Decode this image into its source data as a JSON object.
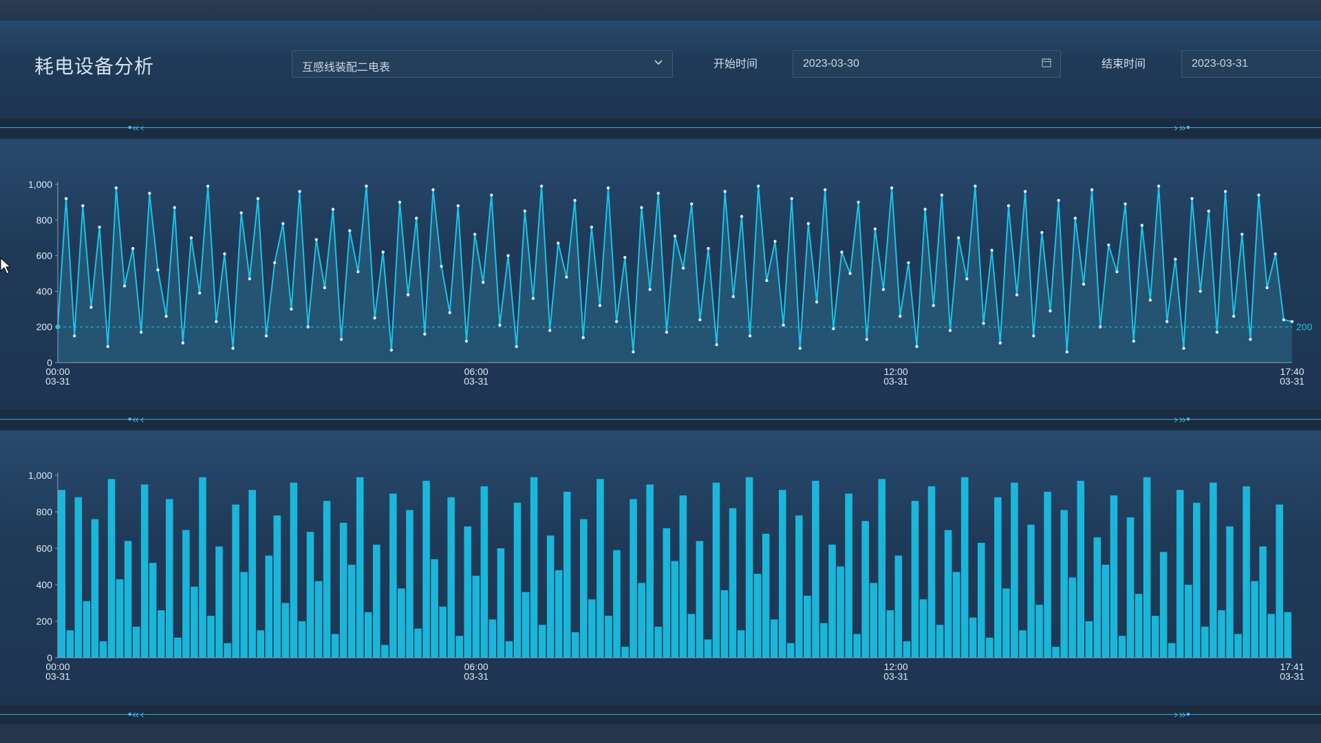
{
  "page": {
    "title": "耗电设备分析",
    "device_select": "互感线装配二电表",
    "start_label": "开始时间",
    "start_date": "2023-03-30",
    "end_label": "结束时间",
    "end_date": "2023-03-31"
  },
  "colors": {
    "accent": "#19c4e8",
    "panel": "#244466",
    "bg": "#1f3147"
  },
  "divider": {
    "left_arrows": "•‹‹ ‹",
    "right_arrows": "› ››•"
  },
  "chart_data": [
    {
      "type": "line",
      "y_ticks": [
        "1,000",
        "800",
        "600",
        "400",
        "200",
        "0"
      ],
      "ylim": [
        0,
        1000
      ],
      "x_ticks": [
        {
          "time": "00:00",
          "date": "03-31"
        },
        {
          "time": "06:00",
          "date": "03-31"
        },
        {
          "time": "12:00",
          "date": "03-31"
        },
        {
          "time": "17:40",
          "date": "03-31"
        }
      ],
      "xlim": [
        "03-31 00:00",
        "03-31 17:40"
      ],
      "markline": {
        "value": 200,
        "label": "200"
      },
      "values": [
        200,
        920,
        150,
        880,
        310,
        760,
        90,
        980,
        430,
        640,
        170,
        950,
        520,
        260,
        870,
        110,
        700,
        390,
        990,
        230,
        610,
        80,
        840,
        470,
        920,
        150,
        560,
        780,
        300,
        960,
        200,
        690,
        420,
        860,
        130,
        740,
        510,
        990,
        250,
        620,
        70,
        900,
        380,
        810,
        160,
        970,
        540,
        280,
        880,
        120,
        720,
        450,
        940,
        210,
        600,
        90,
        850,
        360,
        990,
        180,
        670,
        480,
        910,
        140,
        760,
        320,
        980,
        230,
        590,
        60,
        870,
        410,
        950,
        170,
        710,
        530,
        890,
        240,
        640,
        100,
        960,
        370,
        820,
        150,
        990,
        460,
        680,
        210,
        920,
        80,
        780,
        340,
        970,
        190,
        620,
        500,
        900,
        130,
        750,
        410,
        980,
        260,
        560,
        90,
        860,
        320,
        940,
        180,
        700,
        470,
        990,
        220,
        630,
        110,
        880,
        380,
        960,
        150,
        730,
        290,
        910,
        60,
        810,
        440,
        970,
        200,
        660,
        510,
        890,
        120,
        770,
        350,
        990,
        230,
        580,
        80,
        920,
        400,
        850,
        170,
        960,
        260,
        720,
        130,
        940,
        420,
        610,
        240,
        230
      ]
    },
    {
      "type": "bar",
      "y_ticks": [
        "1,000",
        "800",
        "600",
        "400",
        "200",
        "0"
      ],
      "ylim": [
        0,
        1000
      ],
      "x_ticks": [
        {
          "time": "00:00",
          "date": "03-31"
        },
        {
          "time": "06:00",
          "date": "03-31"
        },
        {
          "time": "12:00",
          "date": "03-31"
        },
        {
          "time": "17:41",
          "date": "03-31"
        }
      ],
      "xlim": [
        "03-31 00:00",
        "03-31 17:41"
      ],
      "values": [
        920,
        150,
        880,
        310,
        760,
        90,
        980,
        430,
        640,
        170,
        950,
        520,
        260,
        870,
        110,
        700,
        390,
        990,
        230,
        610,
        80,
        840,
        470,
        920,
        150,
        560,
        780,
        300,
        960,
        200,
        690,
        420,
        860,
        130,
        740,
        510,
        990,
        250,
        620,
        70,
        900,
        380,
        810,
        160,
        970,
        540,
        280,
        880,
        120,
        720,
        450,
        940,
        210,
        600,
        90,
        850,
        360,
        990,
        180,
        670,
        480,
        910,
        140,
        760,
        320,
        980,
        230,
        590,
        60,
        870,
        410,
        950,
        170,
        710,
        530,
        890,
        240,
        640,
        100,
        960,
        370,
        820,
        150,
        990,
        460,
        680,
        210,
        920,
        80,
        780,
        340,
        970,
        190,
        620,
        500,
        900,
        130,
        750,
        410,
        980,
        260,
        560,
        90,
        860,
        320,
        940,
        180,
        700,
        470,
        990,
        220,
        630,
        110,
        880,
        380,
        960,
        150,
        730,
        290,
        910,
        60,
        810,
        440,
        970,
        200,
        660,
        510,
        890,
        120,
        770,
        350,
        990,
        230,
        580,
        80,
        920,
        400,
        850,
        170,
        960,
        260,
        720,
        130,
        940,
        420,
        610,
        240,
        840,
        250
      ]
    }
  ]
}
